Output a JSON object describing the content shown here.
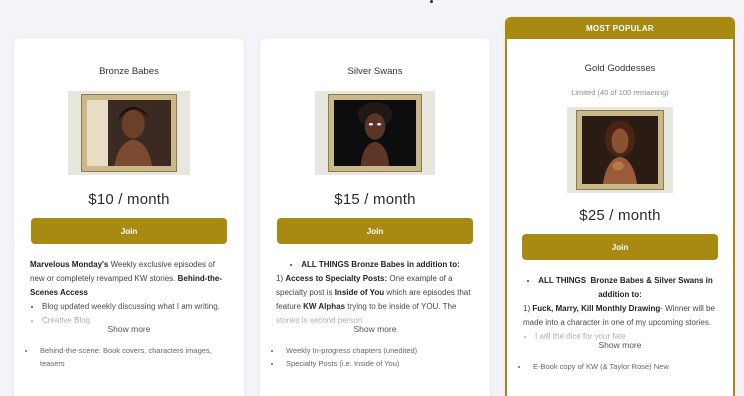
{
  "tiers": [
    {
      "title": "Bronze Babes",
      "price": "$10 / month",
      "join_label": "Join",
      "desc_html": "<b>Marvelous Monday's</b> Weekly exclusive episodes of new or completely revamped KW stories. <b>Behind-the-Scenes Access</b><ul><li>Blog updated weekly discussing what I am writing.</li><li>Creative Blog</li></ul>",
      "show_more": "Show more",
      "benefits": [
        "Behind-the-scene: Book covers, characters images, teasers"
      ]
    },
    {
      "title": "Silver Swans",
      "price": "$15 / month",
      "join_label": "Join",
      "desc_html": "<ul class=\"center\"><li><b>ALL THINGS Bronze Babes in addition to:</b></li></ul>1) <b>Access to Specialty Posts:</b> One example of a specialty post is <b>Inside of You</b> which are episodes that feature <b>KW Alphas</b> trying to be inside of YOU. The stories is second person",
      "show_more": "Show more",
      "benefits": [
        "Weekly In-progress chapters (unedited)",
        "Specialty Posts (i.e. Inside of You)"
      ]
    },
    {
      "popular_label": "MOST POPULAR",
      "title": "Gold Goddesses",
      "subtitle": "Limited (40 of 100 remaining)",
      "price": "$25 / month",
      "join_label": "Join",
      "desc_html": "<ul class=\"center\"><li><b>ALL THINGS&nbsp; Bronze Babes &amp; Silver Swans in addition to:</b></li></ul>1) <b>Fuck, Marry, Kill Monthly Drawing</b>- Winner will be made into a character in one of my upcoming stories.<ul><li>I will the dice for your fate</li></ul>",
      "show_more": "Show more",
      "benefits": [
        "E-Book copy of KW (& Taylor Rose) New"
      ]
    }
  ],
  "colors": {
    "accent": "#a88a12",
    "background": "#f4f3f8",
    "card": "#ffffff"
  }
}
